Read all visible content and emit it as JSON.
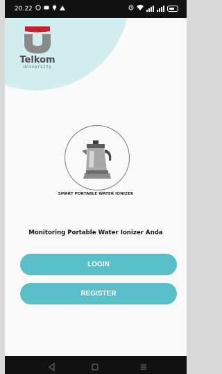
{
  "status_bar": {
    "time": "20.22"
  },
  "logo": {
    "name": "Telkom",
    "sub": "University"
  },
  "emblem": {
    "caption": "SMART PORTABLE WATER IONIZER"
  },
  "tagline": "Monitoring Portable Water Ionizer Anda",
  "buttons": {
    "login": "LOGIN",
    "register": "REGISTER"
  },
  "colors": {
    "accent": "#59bfc8",
    "logo_red": "#c8202e",
    "logo_gray": "#8a8a8a",
    "circle": "#d2eeee"
  },
  "icons": {
    "status_left": [
      "whatsapp-icon",
      "message-icon",
      "location-icon",
      "alert-icon"
    ],
    "status_right": [
      "alarm-icon",
      "wifi-icon",
      "signal-icon",
      "signal-icon",
      "battery-icon"
    ],
    "nav": [
      "back-icon",
      "home-icon",
      "recent-apps-icon"
    ]
  }
}
